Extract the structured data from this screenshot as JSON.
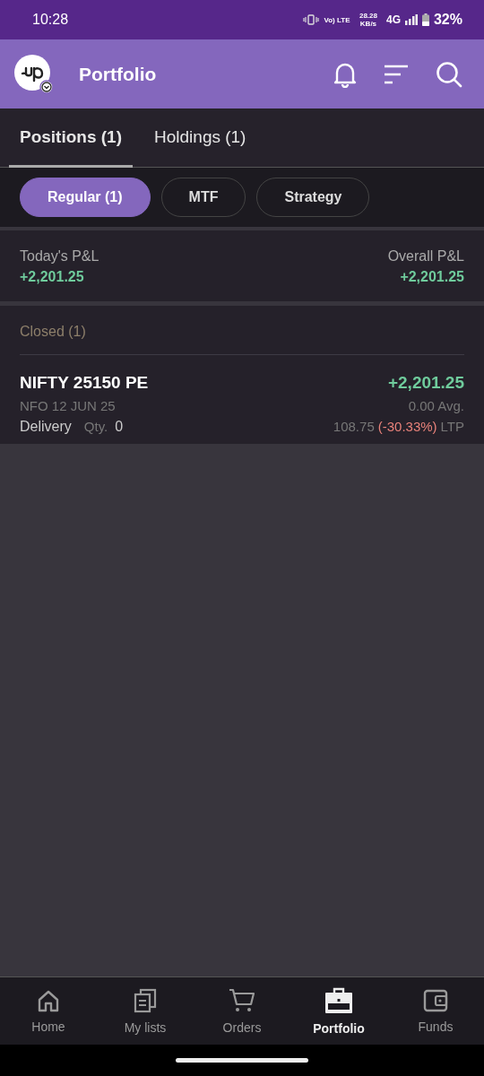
{
  "status_bar": {
    "time": "10:28",
    "volte": "Vo) LTE",
    "speed": "28.28 KB/s",
    "network": "4G",
    "battery": "32%"
  },
  "header": {
    "title": "Portfolio"
  },
  "tabs": [
    {
      "label": "Positions (1)",
      "selected": true
    },
    {
      "label": "Holdings (1)",
      "selected": false
    }
  ],
  "chips": [
    {
      "label": "Regular (1)",
      "selected": true
    },
    {
      "label": "MTF",
      "selected": false
    },
    {
      "label": "Strategy",
      "selected": false
    }
  ],
  "pnl": {
    "today_label": "Today's P&L",
    "today_value": "+2,201.25",
    "overall_label": "Overall P&L",
    "overall_value": "+2,201.25"
  },
  "section": {
    "title": "Closed (1)"
  },
  "positions": [
    {
      "symbol": "NIFTY 25150 PE",
      "pnl": "+2,201.25",
      "contract": "NFO 12 JUN 25",
      "avg": "0.00 Avg.",
      "product": "Delivery",
      "qty_label": "Qty.",
      "qty": "0",
      "ltp": "108.75",
      "change": "(-30.33%)",
      "ltp_label": "LTP"
    }
  ],
  "nav": [
    {
      "label": "Home",
      "kind": "home",
      "selected": false
    },
    {
      "label": "My lists",
      "kind": "lists",
      "selected": false
    },
    {
      "label": "Orders",
      "kind": "cart",
      "selected": false
    },
    {
      "label": "Portfolio",
      "kind": "briefcase",
      "selected": true
    },
    {
      "label": "Funds",
      "kind": "wallet",
      "selected": false
    }
  ]
}
